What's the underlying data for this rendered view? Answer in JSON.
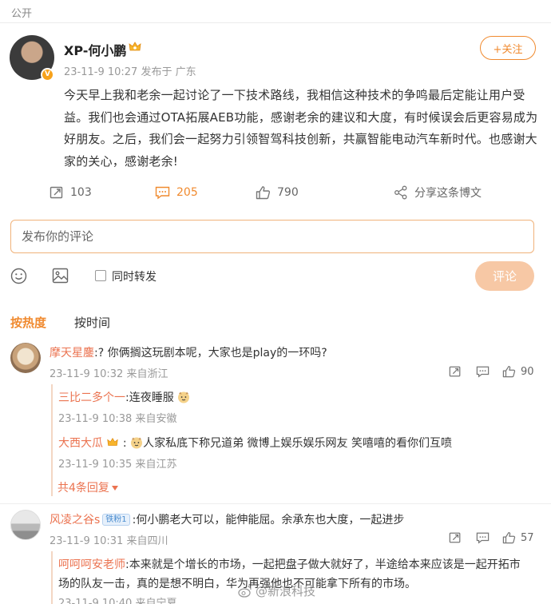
{
  "visibility": "公开",
  "author": {
    "name": "XP-何小鹏",
    "avatar_icon": "avatar-photo",
    "verified_badge": "orange-v-badge",
    "meta": "23-11-9 10:27  发布于 广东",
    "follow_label": "+关注"
  },
  "post": {
    "text": "今天早上我和老余一起讨论了一下技术路线，我相信这种技术的争鸣最后定能让用户受益。我们也会通过OTA拓展AEB功能，感谢老余的建议和大度，有时候误会后更容易成为好朋友。之后，我们会一起努力引领智驾科技创新，共赢智能电动汽车新时代。也感谢大家的关心，感谢老余!"
  },
  "actions": {
    "repost_count": "103",
    "comment_count": "205",
    "like_count": "790",
    "share_label": "分享这条博文",
    "accent": "#f08a2f"
  },
  "composer": {
    "placeholder": "发布你的评论",
    "repost_label": "同时转发",
    "submit_label": "评论"
  },
  "sort": {
    "hot_label": "按热度",
    "time_label": "按时间"
  },
  "comments": [
    {
      "name": "摩天星鏖",
      "text": ":? 你俩搁这玩剧本呢，大家也是play的一环吗?",
      "meta": "23-11-9 10:32 来自浙江",
      "likes": "90",
      "replies": [
        {
          "name": "三比二多个一",
          "text": ":连夜睡服",
          "meta": "23-11-9 10:38 来自安徽"
        },
        {
          "name": "大西大瓜",
          "text": ":人家私底下称兄道弟 微博上娱乐娱乐网友 笑嘻嘻的看你们互喷",
          "meta": "23-11-9 10:35 来自江苏"
        }
      ],
      "more_replies": "共4条回复"
    },
    {
      "name": "风凌之谷s",
      "fan_badge": "铁粉1",
      "text": ":何小鹏老大可以，能伸能屈。余承东也大度，一起进步",
      "meta": "23-11-9 10:31 来自四川",
      "likes": "57",
      "replies": [
        {
          "name": "呵呵呵安老师",
          "text": ":本来就是个增长的市场，一起把盘子做大就好了，半途给本来应该是一起开拓市",
          "text2": "场的队友一击，真的是想不明白，华为再强他也不可能拿下所有的市场。",
          "meta": "23-11-9 10:40 来自宁夏"
        }
      ]
    }
  ],
  "watermark": "@新浪科技"
}
